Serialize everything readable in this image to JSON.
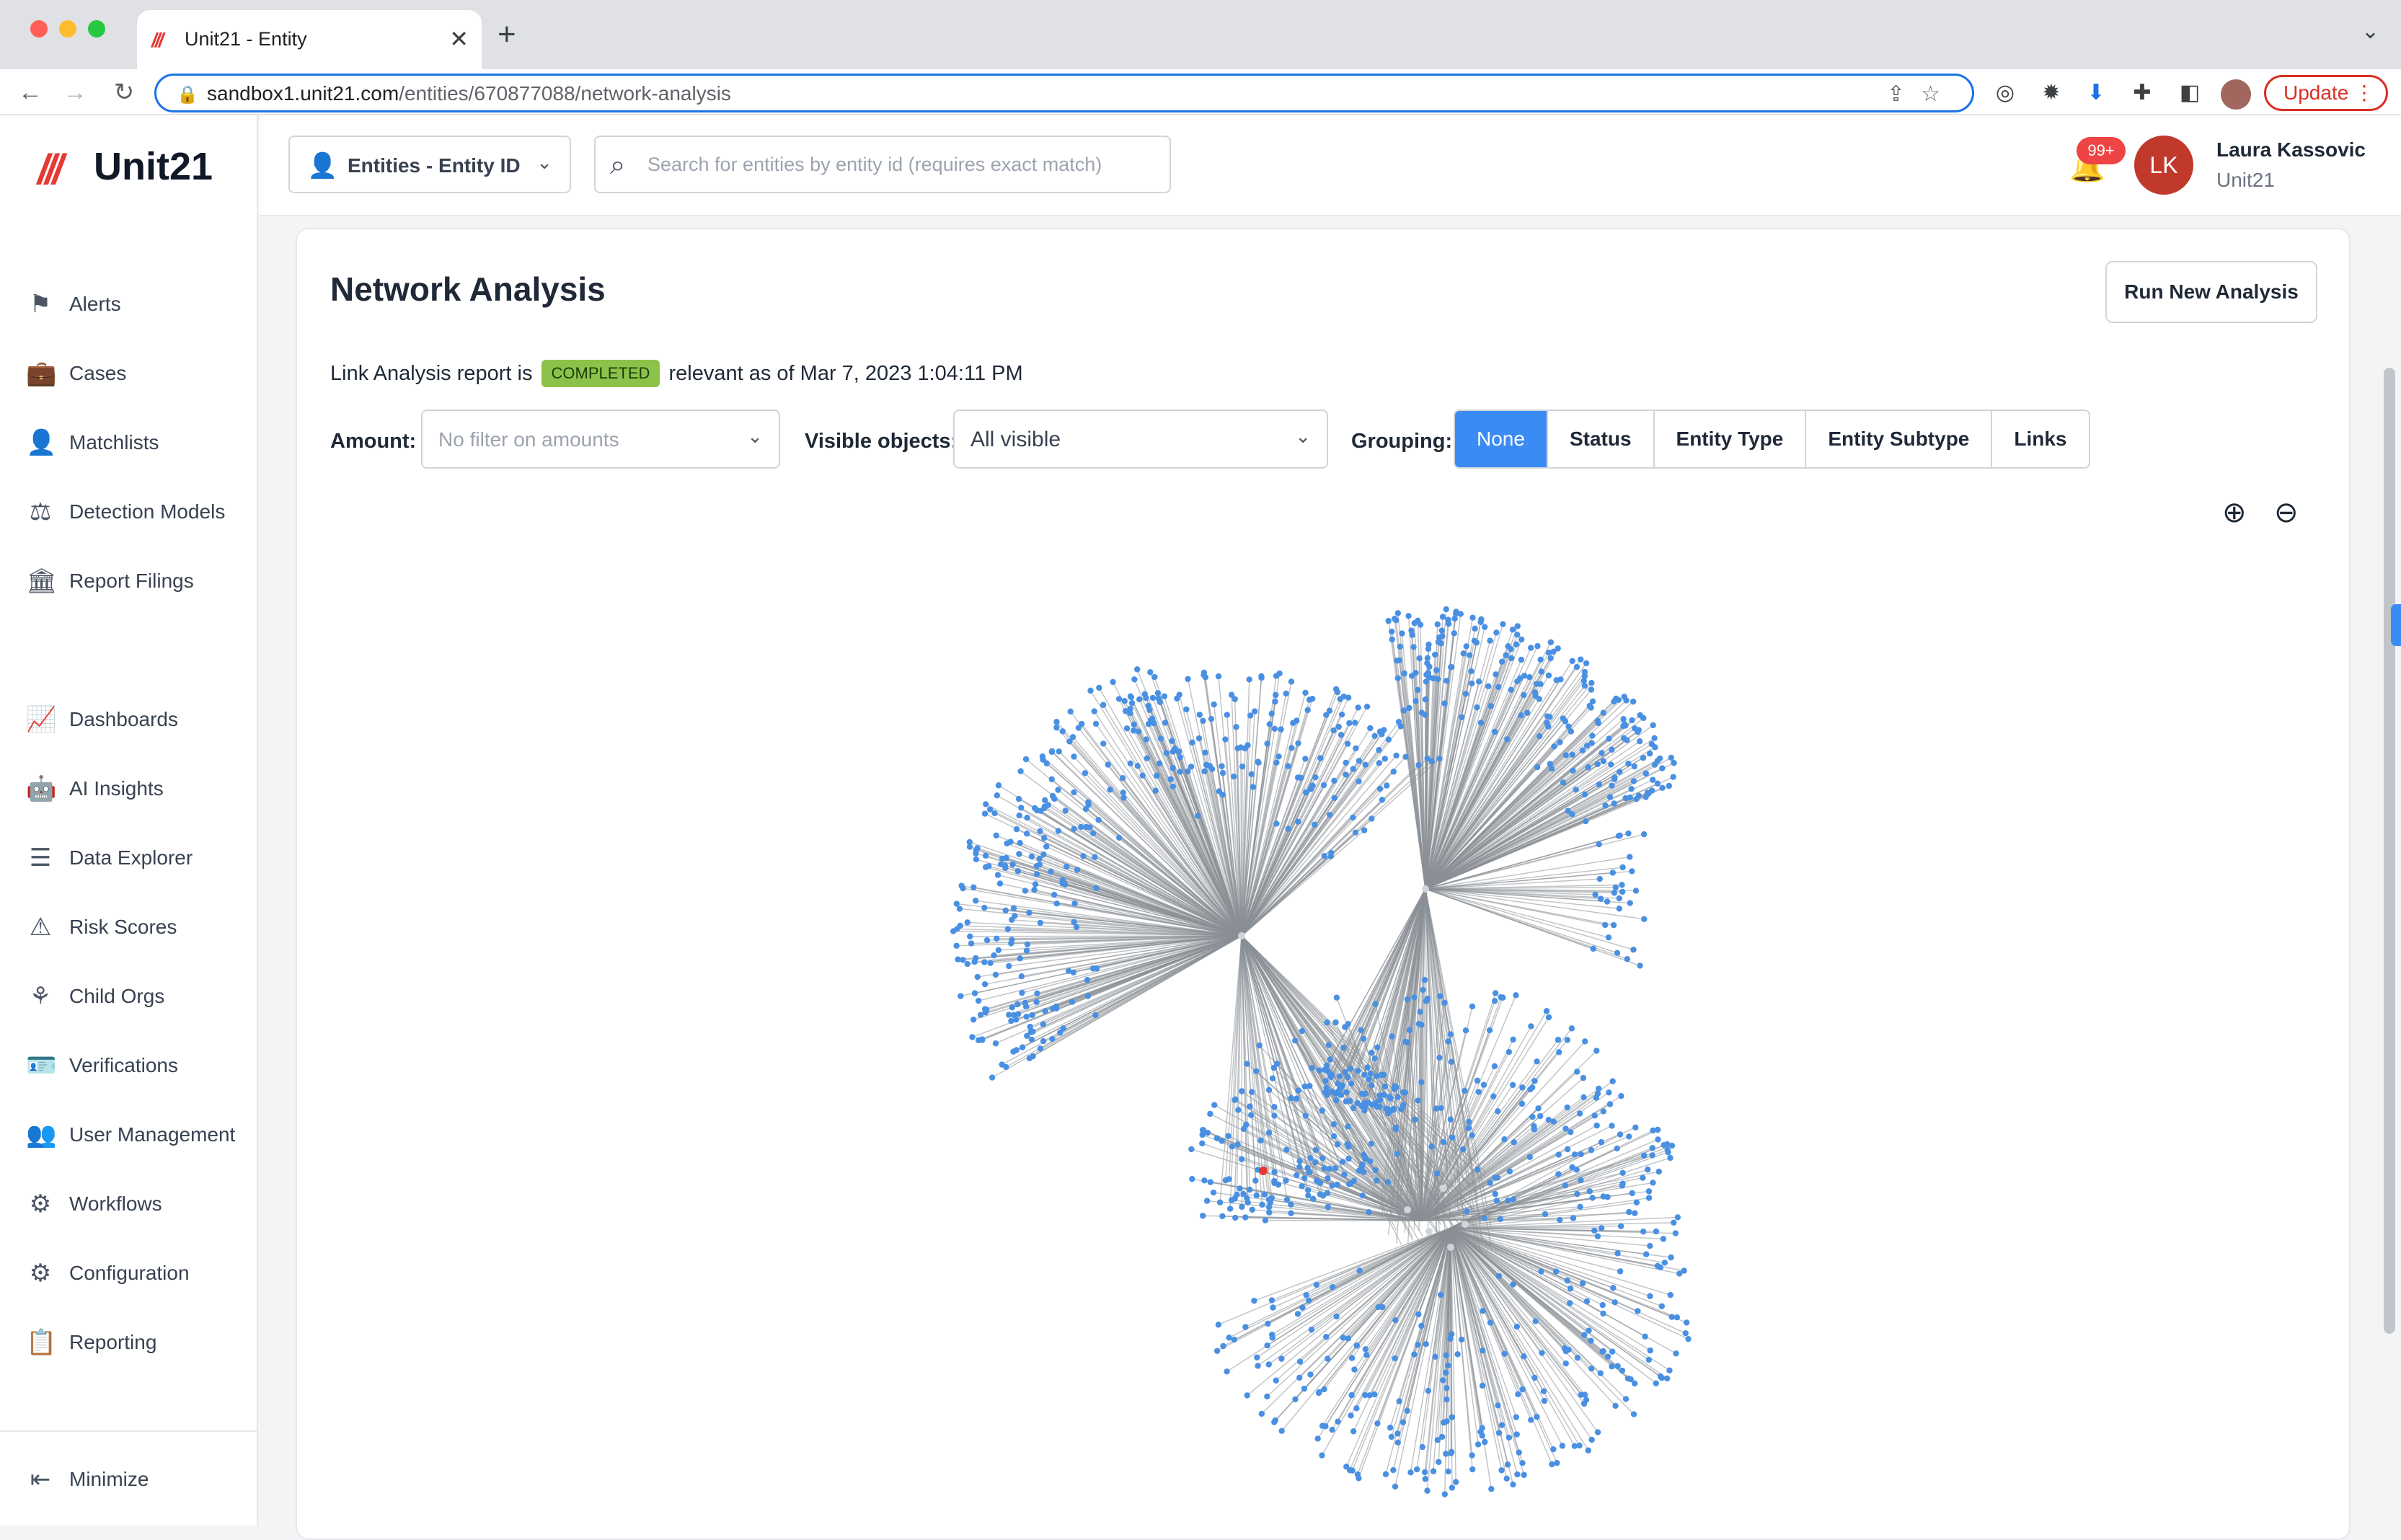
{
  "browser": {
    "tab_title": "Unit21 - Entity",
    "tab_logo": "///",
    "url_host": "sandbox1.unit21.com",
    "url_path": "/entities/670877088/network-analysis",
    "update_label": "Update"
  },
  "app": {
    "logo_mark": "///",
    "logo_text": "Unit21"
  },
  "sidebar": {
    "items": [
      {
        "label": "Alerts",
        "icon": "flag-icon"
      },
      {
        "label": "Cases",
        "icon": "briefcase-icon"
      },
      {
        "label": "Matchlists",
        "icon": "user-x-icon"
      },
      {
        "label": "Detection Models",
        "icon": "scale-icon"
      },
      {
        "label": "Report Filings",
        "icon": "bank-icon"
      },
      {
        "label": "Dashboards",
        "icon": "chart-line-icon"
      },
      {
        "label": "AI Insights",
        "icon": "robot-icon"
      },
      {
        "label": "Data Explorer",
        "icon": "list-search-icon"
      },
      {
        "label": "Risk Scores",
        "icon": "warning-icon"
      },
      {
        "label": "Child Orgs",
        "icon": "hierarchy-icon"
      },
      {
        "label": "Verifications",
        "icon": "id-card-icon"
      },
      {
        "label": "User Management",
        "icon": "users-icon"
      },
      {
        "label": "Workflows",
        "icon": "gear-flow-icon"
      },
      {
        "label": "Configuration",
        "icon": "gear-icon"
      },
      {
        "label": "Reporting",
        "icon": "report-icon"
      }
    ],
    "minimize_label": "Minimize"
  },
  "header": {
    "entity_select_label": "Entities - Entity ID",
    "search_placeholder": "Search for entities by entity id (requires exact match)",
    "notification_count": "99+",
    "user_initials": "LK",
    "user_name": "Laura Kassovic",
    "user_org": "Unit21"
  },
  "main": {
    "title": "Network Analysis",
    "run_button": "Run New Analysis",
    "status_prefix": "Link Analysis report is",
    "status_badge": "COMPLETED",
    "status_suffix": "relevant as of Mar 7, 2023 1:04:11 PM",
    "amount_label": "Amount:",
    "amount_placeholder": "No filter on amounts",
    "visible_label": "Visible objects:",
    "visible_value": "All visible",
    "grouping_label": "Grouping:",
    "grouping_options": [
      "None",
      "Status",
      "Entity Type",
      "Entity Subtype",
      "Links"
    ],
    "grouping_selected": "None"
  },
  "colors": {
    "accent": "#3b8bf5",
    "brand": "#e53935",
    "badge_green": "#8bc34a",
    "node_blue": "#4a90e2",
    "edge_gray": "#8a8f96",
    "alert_node": "#e53935"
  }
}
